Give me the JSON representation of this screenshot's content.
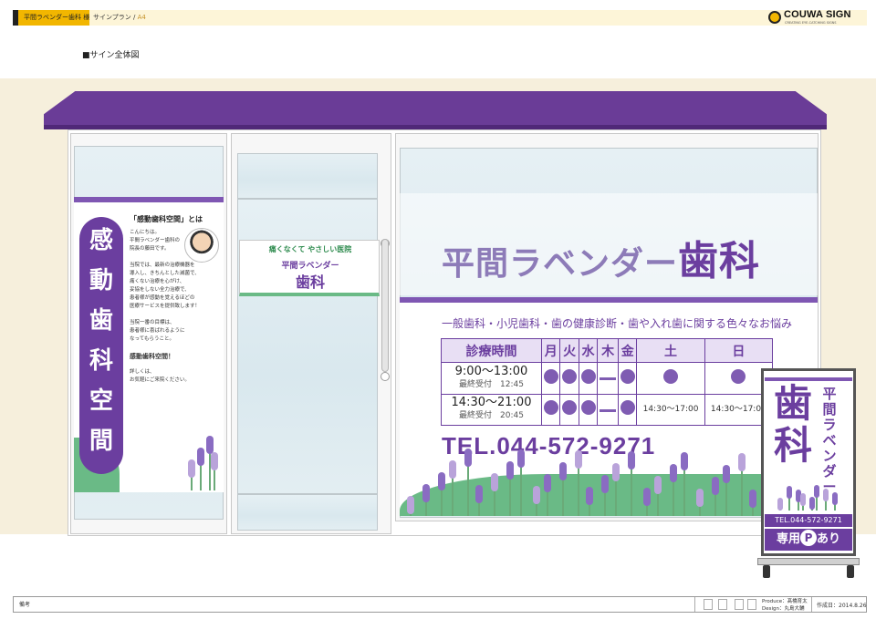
{
  "header": {
    "client": "平間ラベンダー歯科 様",
    "plan": "サインプラン",
    "size": "A4",
    "logo": "COUWA SIGN",
    "logo_sub": "CREATING EYE-CATCHING SIGNS"
  },
  "section_title": "■サイン全体図",
  "left_panel": {
    "vertical_chars": [
      "感",
      "動",
      "歯",
      "科",
      "空",
      "間"
    ],
    "intro_title": "「感動歯科空間」とは",
    "intro_lines": [
      "こんにちは。",
      "平間ラベンダー歯科の",
      "院長の藤田です。",
      "",
      "当院では、最新の治療機器を",
      "導入し、きちんとした滅菌で、",
      "痛くない治療を心がけ、",
      "妥協をしない全力治療で、",
      "患者様が感動を覚えるほどの",
      "医療サービスを提供致します！",
      "",
      "当院一番の目標は、",
      "患者様に喜ばれるように",
      "なってもらうこと。",
      "",
      "感動歯科空間！",
      "",
      "詳しくは、",
      "お気軽にご来院ください。"
    ]
  },
  "door_sign": {
    "tagline": "痛くなくて やさしい医院",
    "name_top": "平間ラベンダー",
    "name_main": "歯科"
  },
  "window": {
    "title_main": "平間ラベンダー",
    "title_accent": "歯科",
    "services": "一般歯科・小児歯科・歯の健康診断・歯や入れ歯に関する色々なお悩み",
    "schedule": {
      "header_label": "診療時間",
      "days": [
        "月",
        "火",
        "水",
        "木",
        "金",
        "土",
        "日"
      ],
      "rows": [
        {
          "time": "9:00〜13:00",
          "last": "最終受付　12:45",
          "marks": [
            "dot",
            "dot",
            "dot",
            "dash",
            "dot",
            "dot",
            "dot"
          ]
        },
        {
          "time": "14:30〜21:00",
          "last": "最終受付　20:45",
          "marks": [
            "dot",
            "dot",
            "dot",
            "dash",
            "dot",
            "14:30〜17:00",
            "14:30〜17:00"
          ]
        }
      ]
    },
    "tel": "TEL.044-572-9271"
  },
  "stand_sign": {
    "main": "歯科",
    "vertical": "平間ラベンダー",
    "tel": "TEL.044-572-9271",
    "parking_pre": "専用",
    "parking_p": "P",
    "parking_post": "あり"
  },
  "footer": {
    "note": "備考",
    "produce": "Produce：髙橋育太",
    "design": "Design：丸島大輔",
    "date": "作成日：2014.8.26"
  },
  "colors": {
    "purple": "#6b3e9f",
    "green": "#6aba86",
    "cream": "#f6efdc"
  }
}
